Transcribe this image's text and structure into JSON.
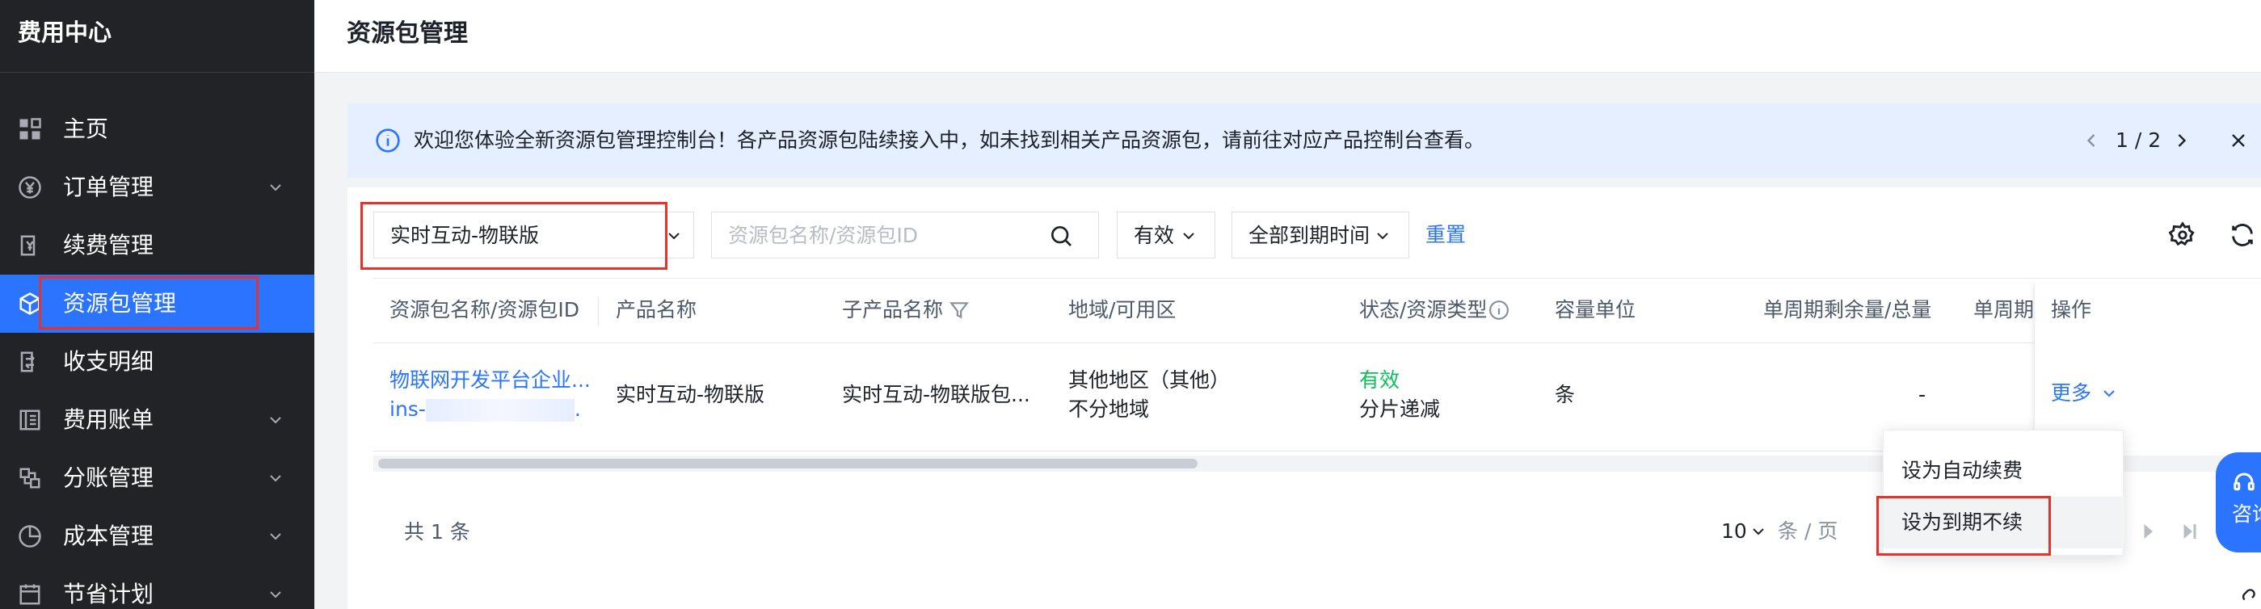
{
  "sidebar": {
    "title": "费用中心",
    "items": [
      {
        "label": "主页",
        "icon": "grid-icon",
        "has_chevron": false
      },
      {
        "label": "订单管理",
        "icon": "yen-circle-icon",
        "has_chevron": true
      },
      {
        "label": "续费管理",
        "icon": "renew-doc-icon",
        "has_chevron": false
      },
      {
        "label": "资源包管理",
        "icon": "cube-icon",
        "has_chevron": false,
        "active": true
      },
      {
        "label": "收支明细",
        "icon": "ledger-icon",
        "has_chevron": false
      },
      {
        "label": "费用账单",
        "icon": "bill-icon",
        "has_chevron": true
      },
      {
        "label": "分账管理",
        "icon": "split-icon",
        "has_chevron": true
      },
      {
        "label": "成本管理",
        "icon": "pie-icon",
        "has_chevron": true
      },
      {
        "label": "节省计划",
        "icon": "plan-icon",
        "has_chevron": true
      }
    ]
  },
  "header": {
    "title": "资源包管理"
  },
  "notice": {
    "text": "欢迎您体验全新资源包管理控制台！各产品资源包陆续接入中，如未找到相关产品资源包，请前往对应产品控制台查看。",
    "page": "1 / 2"
  },
  "filters": {
    "product_select": "实时互动-物联版",
    "search_placeholder": "资源包名称/资源包ID",
    "status_select": "有效",
    "expiry_select": "全部到期时间",
    "reset_label": "重置"
  },
  "table": {
    "columns": [
      "资源包名称/资源包ID",
      "产品名称",
      "子产品名称",
      "地域/可用区",
      "状态/资源类型",
      "容量单位",
      "单周期剩余量/总量",
      "单周期:",
      "操作"
    ],
    "rows": [
      {
        "name": "物联网开发平台企业...",
        "id_prefix": "ins-",
        "id_suffix": ".",
        "product": "实时互动-物联版",
        "sub_product": "实时互动-物联版包...",
        "region_line1": "其他地区（其他）",
        "region_line2": "不分地域",
        "status": "有效",
        "resource_type": "分片递减",
        "unit": "条",
        "remaining": "-",
        "action": "更多"
      }
    ]
  },
  "footer": {
    "total": "共 1 条",
    "page_size": "10",
    "page_unit": "条 / 页"
  },
  "menu": {
    "items": [
      "设为自动续费",
      "设为到期不续"
    ]
  },
  "consult": {
    "label": "咨询"
  },
  "colors": {
    "accent": "#2a74ff",
    "sidebar_bg": "#222327",
    "highlight": "#e5322d",
    "status_green": "#0abf5b",
    "notice_bg": "#e6efff"
  }
}
